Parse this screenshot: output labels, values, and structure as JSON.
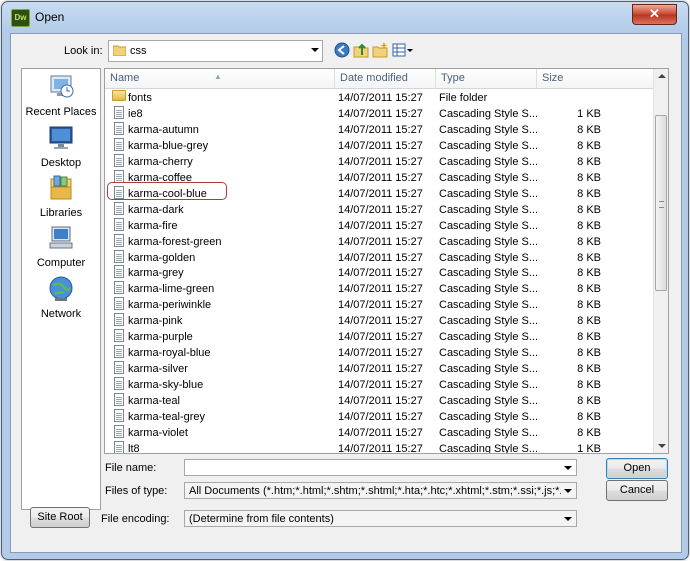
{
  "window": {
    "title": "Open",
    "app_badge": "Dw",
    "close_glyph": "✕"
  },
  "lookin": {
    "label": "Look in:",
    "value": "css"
  },
  "toolbar_icons": [
    "back-icon",
    "up-folder-icon",
    "new-folder-icon",
    "views-icon"
  ],
  "places": [
    {
      "label": "Recent Places",
      "icon": "recent-places-icon"
    },
    {
      "label": "Desktop",
      "icon": "desktop-icon"
    },
    {
      "label": "Libraries",
      "icon": "libraries-icon"
    },
    {
      "label": "Computer",
      "icon": "computer-icon"
    },
    {
      "label": "Network",
      "icon": "network-icon"
    }
  ],
  "columns": {
    "name": "Name",
    "date": "Date modified",
    "type": "Type",
    "size": "Size"
  },
  "files": [
    {
      "name": "fonts",
      "date": "14/07/2011 15:27",
      "type": "File folder",
      "size": "",
      "folder": true
    },
    {
      "name": "ie8",
      "date": "14/07/2011 15:27",
      "type": "Cascading Style S...",
      "size": "1 KB"
    },
    {
      "name": "karma-autumn",
      "date": "14/07/2011 15:27",
      "type": "Cascading Style S...",
      "size": "8 KB"
    },
    {
      "name": "karma-blue-grey",
      "date": "14/07/2011 15:27",
      "type": "Cascading Style S...",
      "size": "8 KB"
    },
    {
      "name": "karma-cherry",
      "date": "14/07/2011 15:27",
      "type": "Cascading Style S...",
      "size": "8 KB",
      "highlighted": true
    },
    {
      "name": "karma-coffee",
      "date": "14/07/2011 15:27",
      "type": "Cascading Style S...",
      "size": "8 KB"
    },
    {
      "name": "karma-cool-blue",
      "date": "14/07/2011 15:27",
      "type": "Cascading Style S...",
      "size": "8 KB"
    },
    {
      "name": "karma-dark",
      "date": "14/07/2011 15:27",
      "type": "Cascading Style S...",
      "size": "8 KB"
    },
    {
      "name": "karma-fire",
      "date": "14/07/2011 15:27",
      "type": "Cascading Style S...",
      "size": "8 KB"
    },
    {
      "name": "karma-forest-green",
      "date": "14/07/2011 15:27",
      "type": "Cascading Style S...",
      "size": "8 KB"
    },
    {
      "name": "karma-golden",
      "date": "14/07/2011 15:27",
      "type": "Cascading Style S...",
      "size": "8 KB"
    },
    {
      "name": "karma-grey",
      "date": "14/07/2011 15:27",
      "type": "Cascading Style S...",
      "size": "8 KB"
    },
    {
      "name": "karma-lime-green",
      "date": "14/07/2011 15:27",
      "type": "Cascading Style S...",
      "size": "8 KB"
    },
    {
      "name": "karma-periwinkle",
      "date": "14/07/2011 15:27",
      "type": "Cascading Style S...",
      "size": "8 KB"
    },
    {
      "name": "karma-pink",
      "date": "14/07/2011 15:27",
      "type": "Cascading Style S...",
      "size": "8 KB"
    },
    {
      "name": "karma-purple",
      "date": "14/07/2011 15:27",
      "type": "Cascading Style S...",
      "size": "8 KB"
    },
    {
      "name": "karma-royal-blue",
      "date": "14/07/2011 15:27",
      "type": "Cascading Style S...",
      "size": "8 KB"
    },
    {
      "name": "karma-silver",
      "date": "14/07/2011 15:27",
      "type": "Cascading Style S...",
      "size": "8 KB"
    },
    {
      "name": "karma-sky-blue",
      "date": "14/07/2011 15:27",
      "type": "Cascading Style S...",
      "size": "8 KB"
    },
    {
      "name": "karma-teal",
      "date": "14/07/2011 15:27",
      "type": "Cascading Style S...",
      "size": "8 KB"
    },
    {
      "name": "karma-teal-grey",
      "date": "14/07/2011 15:27",
      "type": "Cascading Style S...",
      "size": "8 KB"
    },
    {
      "name": "karma-violet",
      "date": "14/07/2011 15:27",
      "type": "Cascading Style S...",
      "size": "8 KB"
    },
    {
      "name": "lt8",
      "date": "14/07/2011 15:27",
      "type": "Cascading Style S...",
      "size": "1 KB"
    }
  ],
  "filename": {
    "label": "File name:",
    "value": ""
  },
  "filetype": {
    "label": "Files of type:",
    "value": "All Documents (*.htm;*.html;*.shtm;*.shtml;*.hta;*.htc;*.xhtml;*.stm;*.ssi;*.js;*.json;*.as;*.asr;"
  },
  "encoding": {
    "label": "File encoding:",
    "value": "(Determine from file contents)"
  },
  "buttons": {
    "open": "Open",
    "cancel": "Cancel",
    "site_root": "Site Root"
  },
  "colors": {
    "highlight_border": "#b23a3a",
    "title_bar": "#c9dcf2",
    "close_button": "#c8452f"
  }
}
